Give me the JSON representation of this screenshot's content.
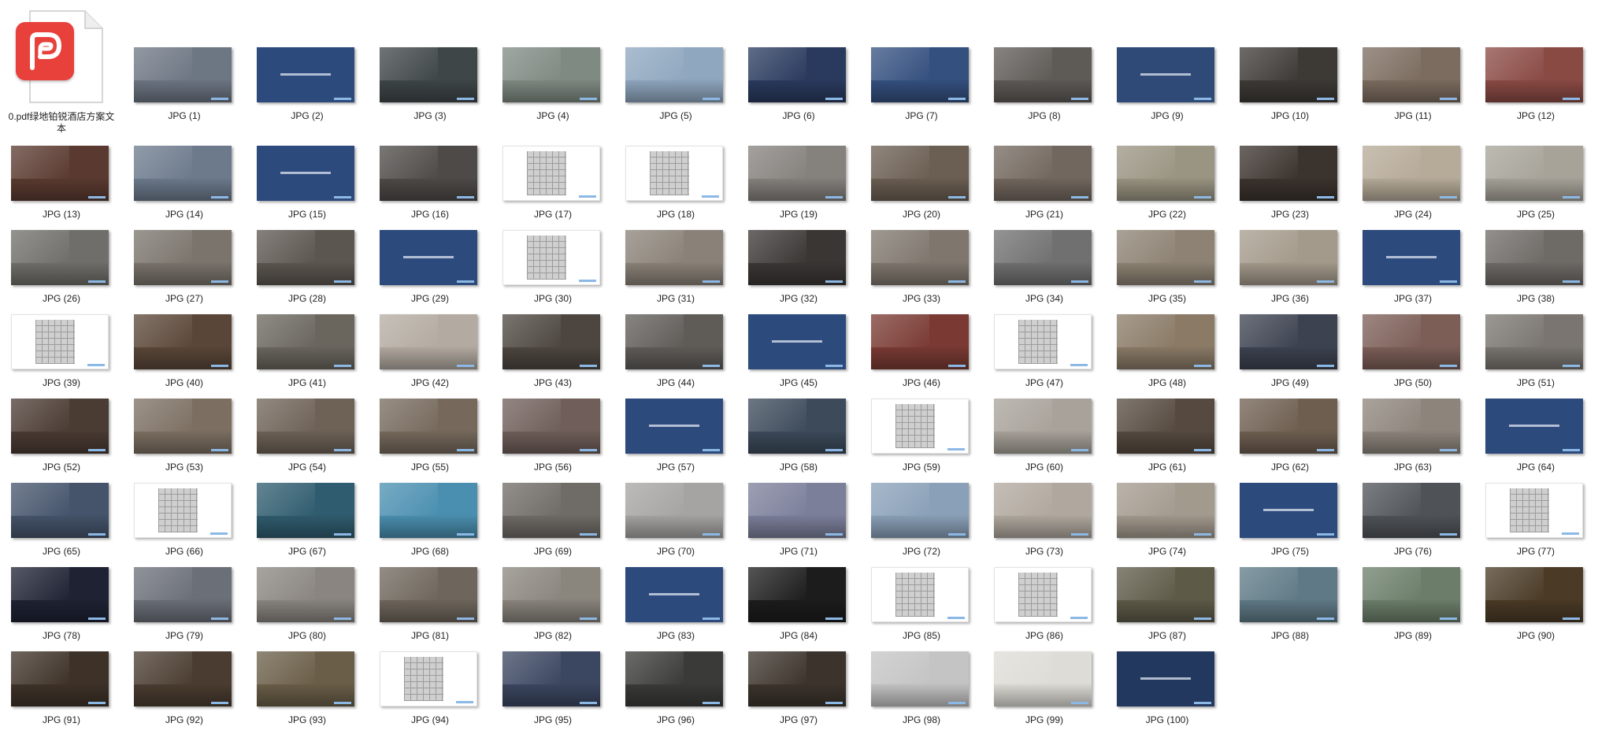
{
  "window": {
    "background": "#ffffff"
  },
  "pdf_file": {
    "name": "0.pdf绿地铂锐酒店方案文本",
    "icon": "pdf-document-icon",
    "accent": "#e8403a"
  },
  "thumbnails": [
    {
      "label": "JPG (1)",
      "kind": "photo",
      "color": "#6d7683"
    },
    {
      "label": "JPG (2)",
      "kind": "blue",
      "color": "#2c4a7c"
    },
    {
      "label": "JPG (3)",
      "kind": "photo",
      "color": "#3f4648"
    },
    {
      "label": "JPG (4)",
      "kind": "photo",
      "color": "#7f8a82"
    },
    {
      "label": "JPG (5)",
      "kind": "photo",
      "color": "#8fa7bf"
    },
    {
      "label": "JPG (6)",
      "kind": "photo",
      "color": "#2a3a5e"
    },
    {
      "label": "JPG (7)",
      "kind": "photo",
      "color": "#34507f"
    },
    {
      "label": "JPG (8)",
      "kind": "photo",
      "color": "#5e5a56"
    },
    {
      "label": "JPG (9)",
      "kind": "blue",
      "color": "#2f4a77"
    },
    {
      "label": "JPG (10)",
      "kind": "photo",
      "color": "#3d3a36"
    },
    {
      "label": "JPG (11)",
      "kind": "photo",
      "color": "#7c6c5f"
    },
    {
      "label": "JPG (12)",
      "kind": "photo",
      "color": "#8a4a44"
    },
    {
      "label": "JPG (13)",
      "kind": "photo",
      "color": "#5a3a30"
    },
    {
      "label": "JPG (14)",
      "kind": "photo",
      "color": "#6c7a8c"
    },
    {
      "label": "JPG (15)",
      "kind": "blue",
      "color": "#2c4a7c"
    },
    {
      "label": "JPG (16)",
      "kind": "photo",
      "color": "#4d4a47"
    },
    {
      "label": "JPG (17)",
      "kind": "white",
      "color": "#ffffff"
    },
    {
      "label": "JPG (18)",
      "kind": "white",
      "color": "#ffffff"
    },
    {
      "label": "JPG (19)",
      "kind": "photo",
      "color": "#85817d"
    },
    {
      "label": "JPG (20)",
      "kind": "photo",
      "color": "#6b5e52"
    },
    {
      "label": "JPG (21)",
      "kind": "photo",
      "color": "#72675e"
    },
    {
      "label": "JPG (22)",
      "kind": "photo",
      "color": "#9a9482"
    },
    {
      "label": "JPG (23)",
      "kind": "photo",
      "color": "#3b332e"
    },
    {
      "label": "JPG (24)",
      "kind": "photo",
      "color": "#b6aa98"
    },
    {
      "label": "JPG (25)",
      "kind": "photo",
      "color": "#a7a399"
    },
    {
      "label": "JPG (26)",
      "kind": "photo",
      "color": "#6f6e6a"
    },
    {
      "label": "JPG (27)",
      "kind": "photo",
      "color": "#7a746c"
    },
    {
      "label": "JPG (28)",
      "kind": "photo",
      "color": "#5c5650"
    },
    {
      "label": "JPG (29)",
      "kind": "blue",
      "color": "#2c4a7c"
    },
    {
      "label": "JPG (30)",
      "kind": "white",
      "color": "#ffffff"
    },
    {
      "label": "JPG (31)",
      "kind": "photo",
      "color": "#8a8278"
    },
    {
      "label": "JPG (32)",
      "kind": "photo",
      "color": "#3a3634"
    },
    {
      "label": "JPG (33)",
      "kind": "photo",
      "color": "#7f776e"
    },
    {
      "label": "JPG (34)",
      "kind": "photo",
      "color": "#707070"
    },
    {
      "label": "JPG (35)",
      "kind": "photo",
      "color": "#8d8273"
    },
    {
      "label": "JPG (36)",
      "kind": "photo",
      "color": "#a49a8b"
    },
    {
      "label": "JPG (37)",
      "kind": "blue",
      "color": "#2c4a7c"
    },
    {
      "label": "JPG (38)",
      "kind": "photo",
      "color": "#6e6a66"
    },
    {
      "label": "JPG (39)",
      "kind": "white",
      "color": "#ffffff"
    },
    {
      "label": "JPG (40)",
      "kind": "photo",
      "color": "#5a4638"
    },
    {
      "label": "JPG (41)",
      "kind": "photo",
      "color": "#6a665e"
    },
    {
      "label": "JPG (42)",
      "kind": "photo",
      "color": "#b3aba1"
    },
    {
      "label": "JPG (43)",
      "kind": "photo",
      "color": "#4d4640"
    },
    {
      "label": "JPG (44)",
      "kind": "photo",
      "color": "#5f5c58"
    },
    {
      "label": "JPG (45)",
      "kind": "blue",
      "color": "#2c4a7c"
    },
    {
      "label": "JPG (46)",
      "kind": "photo",
      "color": "#7a3a33"
    },
    {
      "label": "JPG (47)",
      "kind": "white",
      "color": "#ffffff"
    },
    {
      "label": "JPG (48)",
      "kind": "photo",
      "color": "#8a7a66"
    },
    {
      "label": "JPG (49)",
      "kind": "photo",
      "color": "#3d4250"
    },
    {
      "label": "JPG (50)",
      "kind": "photo",
      "color": "#7c5e57"
    },
    {
      "label": "JPG (51)",
      "kind": "photo",
      "color": "#7a7570"
    },
    {
      "label": "JPG (52)",
      "kind": "photo",
      "color": "#4a3b33"
    },
    {
      "label": "JPG (53)",
      "kind": "photo",
      "color": "#7c6f62"
    },
    {
      "label": "JPG (54)",
      "kind": "photo",
      "color": "#6e6257"
    },
    {
      "label": "JPG (55)",
      "kind": "photo",
      "color": "#76695c"
    },
    {
      "label": "JPG (56)",
      "kind": "photo",
      "color": "#6f5e59"
    },
    {
      "label": "JPG (57)",
      "kind": "blue",
      "color": "#2c4a7c"
    },
    {
      "label": "JPG (58)",
      "kind": "photo",
      "color": "#3c4a5a"
    },
    {
      "label": "JPG (59)",
      "kind": "white",
      "color": "#ffffff"
    },
    {
      "label": "JPG (60)",
      "kind": "photo",
      "color": "#a8a29a"
    },
    {
      "label": "JPG (61)",
      "kind": "photo",
      "color": "#564a40"
    },
    {
      "label": "JPG (62)",
      "kind": "photo",
      "color": "#6e5e50"
    },
    {
      "label": "JPG (63)",
      "kind": "photo",
      "color": "#8d857c"
    },
    {
      "label": "JPG (64)",
      "kind": "blue",
      "color": "#2c4a7c"
    },
    {
      "label": "JPG (65)",
      "kind": "photo",
      "color": "#45546b"
    },
    {
      "label": "JPG (66)",
      "kind": "white",
      "color": "#ffffff"
    },
    {
      "label": "JPG (67)",
      "kind": "photo",
      "color": "#2f5c6e"
    },
    {
      "label": "JPG (68)",
      "kind": "photo",
      "color": "#4a8fb0"
    },
    {
      "label": "JPG (69)",
      "kind": "photo",
      "color": "#6f6b66"
    },
    {
      "label": "JPG (70)",
      "kind": "photo",
      "color": "#a6a4a2"
    },
    {
      "label": "JPG (71)",
      "kind": "photo",
      "color": "#7c7f9a"
    },
    {
      "label": "JPG (72)",
      "kind": "photo",
      "color": "#8aa0b8"
    },
    {
      "label": "JPG (73)",
      "kind": "photo",
      "color": "#b0a89e"
    },
    {
      "label": "JPG (74)",
      "kind": "photo",
      "color": "#a39a8e"
    },
    {
      "label": "JPG (75)",
      "kind": "blue",
      "color": "#2c4a7c"
    },
    {
      "label": "JPG (76)",
      "kind": "photo",
      "color": "#4f5358"
    },
    {
      "label": "JPG (77)",
      "kind": "white",
      "color": "#ffffff"
    },
    {
      "label": "JPG (78)",
      "kind": "photo",
      "color": "#1e2233"
    },
    {
      "label": "JPG (79)",
      "kind": "photo",
      "color": "#6b6f78"
    },
    {
      "label": "JPG (80)",
      "kind": "photo",
      "color": "#8a8580"
    },
    {
      "label": "JPG (81)",
      "kind": "photo",
      "color": "#6e665c"
    },
    {
      "label": "JPG (82)",
      "kind": "photo",
      "color": "#8a857d"
    },
    {
      "label": "JPG (83)",
      "kind": "blue",
      "color": "#2c4a7c"
    },
    {
      "label": "JPG (84)",
      "kind": "photo",
      "color": "#1c1c1c"
    },
    {
      "label": "JPG (85)",
      "kind": "white",
      "color": "#ffffff"
    },
    {
      "label": "JPG (86)",
      "kind": "white",
      "color": "#ffffff"
    },
    {
      "label": "JPG (87)",
      "kind": "photo",
      "color": "#5e5a48"
    },
    {
      "label": "JPG (88)",
      "kind": "photo",
      "color": "#5f7a86"
    },
    {
      "label": "JPG (89)",
      "kind": "photo",
      "color": "#6c7e6a"
    },
    {
      "label": "JPG (90)",
      "kind": "photo",
      "color": "#4a3a26"
    },
    {
      "label": "JPG (91)",
      "kind": "photo",
      "color": "#3e3228"
    },
    {
      "label": "JPG (92)",
      "kind": "photo",
      "color": "#4a3c30"
    },
    {
      "label": "JPG (93)",
      "kind": "photo",
      "color": "#6a5e48"
    },
    {
      "label": "JPG (94)",
      "kind": "white",
      "color": "#ffffff"
    },
    {
      "label": "JPG (95)",
      "kind": "photo",
      "color": "#3b4660"
    },
    {
      "label": "JPG (96)",
      "kind": "photo",
      "color": "#3a3a38"
    },
    {
      "label": "JPG (97)",
      "kind": "photo",
      "color": "#3c342c"
    },
    {
      "label": "JPG (98)",
      "kind": "photo",
      "color": "#c4c4c4"
    },
    {
      "label": "JPG (99)",
      "kind": "photo",
      "color": "#dedcd6"
    },
    {
      "label": "JPG (100)",
      "kind": "blue",
      "color": "#22385e"
    }
  ]
}
